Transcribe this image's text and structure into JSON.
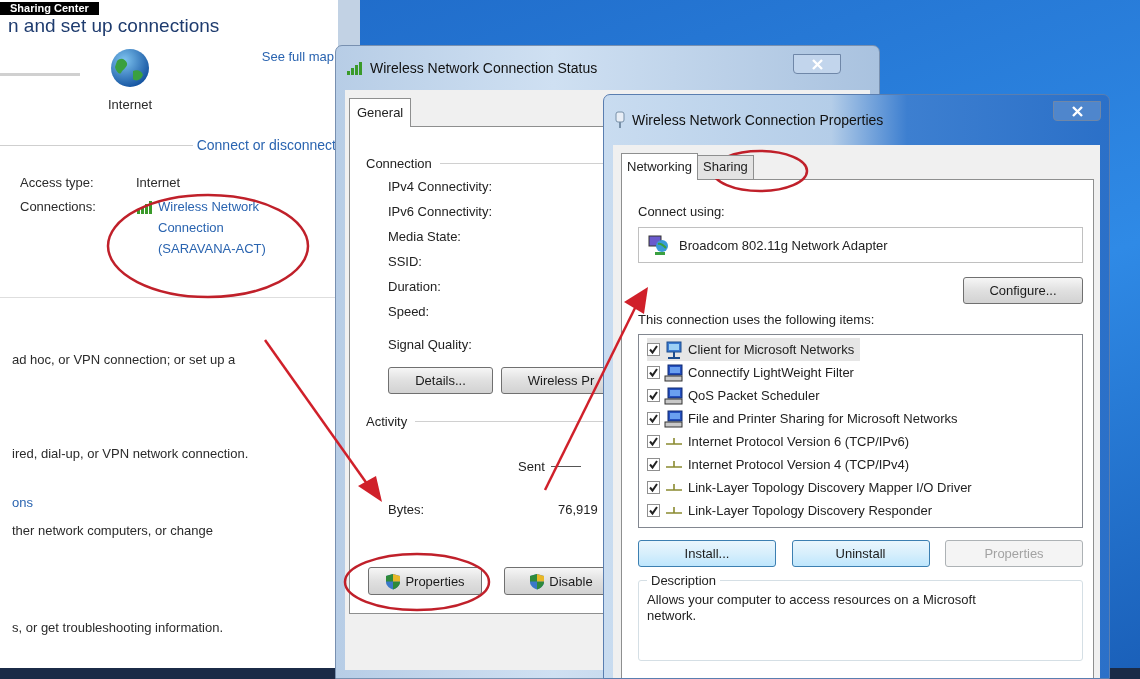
{
  "banner": {
    "title": "Sharing Center"
  },
  "network_center": {
    "heading": "n and set up connections",
    "map": {
      "node_label": "Internet",
      "see_full_map": "See full map"
    },
    "connect_link": "Connect or disconnect",
    "access_type": {
      "label": "Access type:",
      "value": "Internet"
    },
    "connections": {
      "label": "Connections:",
      "link": "Wireless Network Connection (SARAVANA-ACT)"
    },
    "tasks": [
      {
        "kind": "text",
        "text": "ad hoc, or VPN connection; or set up a"
      },
      {
        "kind": "text",
        "text": "ired, dial-up, or VPN network connection."
      },
      {
        "kind": "link",
        "text": "ons"
      },
      {
        "kind": "text",
        "text": "ther network computers, or change"
      },
      {
        "kind": "text",
        "text": "s, or get troubleshooting information."
      }
    ]
  },
  "status_window": {
    "title": "Wireless Network Connection Status",
    "tabs": [
      {
        "label": "General",
        "selected": true
      }
    ],
    "connection_group": "Connection",
    "fields": [
      "IPv4 Connectivity:",
      "IPv6 Connectivity:",
      "Media State:",
      "SSID:",
      "Duration:",
      "Speed:",
      "Signal Quality:"
    ],
    "buttons": [
      "Details...",
      "Wireless Pr"
    ],
    "activity_group": "Activity",
    "sent_label": "Sent",
    "bytes_label": "Bytes:",
    "bytes_sent": "76,919",
    "bottom_buttons": [
      "Properties",
      "Disable"
    ]
  },
  "properties_window": {
    "title": "Wireless Network Connection Properties",
    "tabs": [
      {
        "label": "Networking",
        "selected": true
      },
      {
        "label": "Sharing",
        "selected": false
      }
    ],
    "connect_using_label": "Connect using:",
    "adapter": "Broadcom 802.11g Network Adapter",
    "configure_button": "Configure...",
    "items_label": "This connection uses the following items:",
    "items": [
      {
        "kind": "client",
        "label": "Client for Microsoft Networks",
        "checked": true,
        "selected": true
      },
      {
        "kind": "service",
        "label": "Connectify LightWeight Filter",
        "checked": true,
        "selected": false
      },
      {
        "kind": "service",
        "label": "QoS Packet Scheduler",
        "checked": true,
        "selected": false
      },
      {
        "kind": "service",
        "label": "File and Printer Sharing for Microsoft Networks",
        "checked": true,
        "selected": false
      },
      {
        "kind": "protocol",
        "label": "Internet Protocol Version 6 (TCP/IPv6)",
        "checked": true,
        "selected": false
      },
      {
        "kind": "protocol",
        "label": "Internet Protocol Version 4 (TCP/IPv4)",
        "checked": true,
        "selected": false
      },
      {
        "kind": "protocol",
        "label": "Link-Layer Topology Discovery Mapper I/O Driver",
        "checked": true,
        "selected": false
      },
      {
        "kind": "protocol",
        "label": "Link-Layer Topology Discovery Responder",
        "checked": true,
        "selected": false
      }
    ],
    "buttons": [
      {
        "label": "Install...",
        "disabled": false
      },
      {
        "label": "Uninstall",
        "disabled": false
      },
      {
        "label": "Properties",
        "disabled": true
      }
    ],
    "description": {
      "label": "Description",
      "text": "Allows your computer to access resources on a Microsoft network."
    }
  }
}
